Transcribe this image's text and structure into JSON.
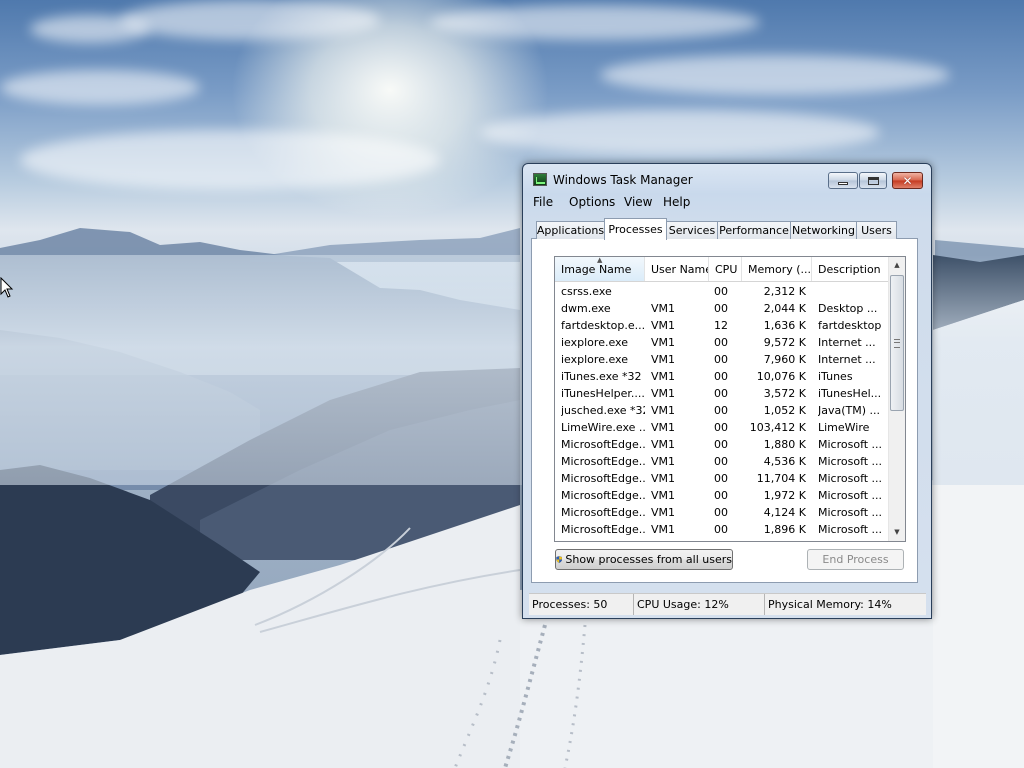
{
  "window": {
    "title": "Windows Task Manager",
    "accent_close": "#c4391f"
  },
  "menu": [
    "File",
    "Options",
    "View",
    "Help"
  ],
  "tabs": [
    {
      "label": "Applications",
      "active": false
    },
    {
      "label": "Processes",
      "active": true
    },
    {
      "label": "Services",
      "active": false
    },
    {
      "label": "Performance",
      "active": false
    },
    {
      "label": "Networking",
      "active": false
    },
    {
      "label": "Users",
      "active": false
    }
  ],
  "columns": [
    "Image Name",
    "User Name",
    "CPU",
    "Memory (...",
    "Description"
  ],
  "processes": [
    {
      "name": "csrss.exe",
      "user": "",
      "cpu": "00",
      "mem": "2,312 K",
      "desc": ""
    },
    {
      "name": "dwm.exe",
      "user": "VM1",
      "cpu": "00",
      "mem": "2,044 K",
      "desc": "Desktop ..."
    },
    {
      "name": "fartdesktop.e...",
      "user": "VM1",
      "cpu": "12",
      "mem": "1,636 K",
      "desc": "fartdesktop"
    },
    {
      "name": "iexplore.exe",
      "user": "VM1",
      "cpu": "00",
      "mem": "9,572 K",
      "desc": "Internet ..."
    },
    {
      "name": "iexplore.exe",
      "user": "VM1",
      "cpu": "00",
      "mem": "7,960 K",
      "desc": "Internet ..."
    },
    {
      "name": "iTunes.exe *32",
      "user": "VM1",
      "cpu": "00",
      "mem": "10,076 K",
      "desc": "iTunes"
    },
    {
      "name": "iTunesHelper....",
      "user": "VM1",
      "cpu": "00",
      "mem": "3,572 K",
      "desc": "iTunesHel..."
    },
    {
      "name": "jusched.exe *32",
      "user": "VM1",
      "cpu": "00",
      "mem": "1,052 K",
      "desc": "Java(TM) ..."
    },
    {
      "name": "LimeWire.exe ...",
      "user": "VM1",
      "cpu": "00",
      "mem": "103,412 K",
      "desc": "LimeWire"
    },
    {
      "name": "MicrosoftEdge...",
      "user": "VM1",
      "cpu": "00",
      "mem": "1,880 K",
      "desc": "Microsoft ..."
    },
    {
      "name": "MicrosoftEdge...",
      "user": "VM1",
      "cpu": "00",
      "mem": "4,536 K",
      "desc": "Microsoft ..."
    },
    {
      "name": "MicrosoftEdge...",
      "user": "VM1",
      "cpu": "00",
      "mem": "11,704 K",
      "desc": "Microsoft ..."
    },
    {
      "name": "MicrosoftEdge...",
      "user": "VM1",
      "cpu": "00",
      "mem": "1,972 K",
      "desc": "Microsoft ..."
    },
    {
      "name": "MicrosoftEdge...",
      "user": "VM1",
      "cpu": "00",
      "mem": "4,124 K",
      "desc": "Microsoft ..."
    },
    {
      "name": "MicrosoftEdge...",
      "user": "VM1",
      "cpu": "00",
      "mem": "1,896 K",
      "desc": "Microsoft ..."
    }
  ],
  "buttons": {
    "show_all": "Show processes from all users",
    "end_process": "End Process"
  },
  "status": {
    "processes": "Processes: 50",
    "cpu": "CPU Usage: 12%",
    "memory": "Physical Memory: 14%"
  }
}
